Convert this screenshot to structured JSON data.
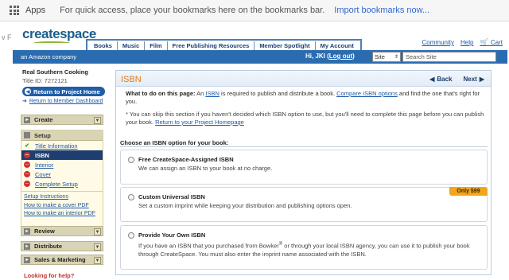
{
  "bookmarks_bar": {
    "apps_label": "Apps",
    "hint_text": "For quick access, place your bookmarks here on the bookmarks bar.",
    "import_link": "Import bookmarks now..."
  },
  "header": {
    "left_partial": "v F",
    "logo_text": "createspace",
    "nav_tabs": [
      "Books",
      "Music",
      "Film",
      "Free Publishing Resources",
      "Member Spotlight",
      "My Account"
    ],
    "top_links": {
      "community": "Community",
      "help": "Help",
      "cart": "Cart"
    },
    "amazon_company": "an Amazon company",
    "greeting_prefix": "Hi, JKI (",
    "logout_label": "Log out",
    "greeting_suffix": ")",
    "site_select_value": "Site",
    "search_placeholder": "Search Site"
  },
  "sidebar": {
    "project_name": "Real Southern Cooking",
    "title_id": "Title ID: 7272121",
    "return_project_home": "Return to Project Home",
    "return_dashboard": "Return to Member Dashboard",
    "sections": {
      "create": "Create",
      "setup": "Setup",
      "review": "Review",
      "distribute": "Distribute",
      "sales": "Sales & Marketing"
    },
    "setup_items": [
      {
        "label": "Title Information",
        "status": "complete"
      },
      {
        "label": "ISBN",
        "status": "active"
      },
      {
        "label": "Interior",
        "status": "incomplete"
      },
      {
        "label": "Cover",
        "status": "incomplete"
      },
      {
        "label": "Complete Setup",
        "status": "incomplete"
      }
    ],
    "setup_links": [
      "Setup Instructions",
      "How to make a cover PDF",
      "How to make an interior PDF"
    ],
    "looking_for_help": "Looking for help?"
  },
  "main": {
    "title": "ISBN",
    "back_label": "Back",
    "next_label": "Next",
    "intro_bold": "What to do on this page:",
    "intro_pre": " An ",
    "intro_isbn_link": "ISBN",
    "intro_mid": " is required to publish and distribute a book. ",
    "intro_compare_link": "Compare ISBN options",
    "intro_post": " and find the one that's right for you.",
    "note_pre": "* You can skip this section if you haven't decided which ISBN option to use, but you'll need to complete this page before you can publish your book. ",
    "note_link": "Return to your Project Homepage",
    "choose_heading": "Choose an ISBN option for your book:",
    "options": [
      {
        "title": "Free CreateSpace-Assigned ISBN",
        "description": "We can assign an ISBN to your book at no charge.",
        "price": ""
      },
      {
        "title": "Custom Universal ISBN",
        "description": "Set a custom imprint while keeping your distribution and publishing options open.",
        "price": "Only $99"
      },
      {
        "title": "Provide Your Own ISBN",
        "description_pre": "If you have an ISBN that you purchased from Bowker",
        "description_sup": "®",
        "description_post": " or through your local ISBN agency, you can use it to publish your book through CreateSpace. You must also enter the imprint name associated with the ISBN.",
        "price": ""
      }
    ]
  },
  "colors": {
    "brand_blue": "#2b6cb0",
    "title_orange": "#e07b1a",
    "price_badge": "#f3a51b",
    "help_red": "#c4332b"
  }
}
